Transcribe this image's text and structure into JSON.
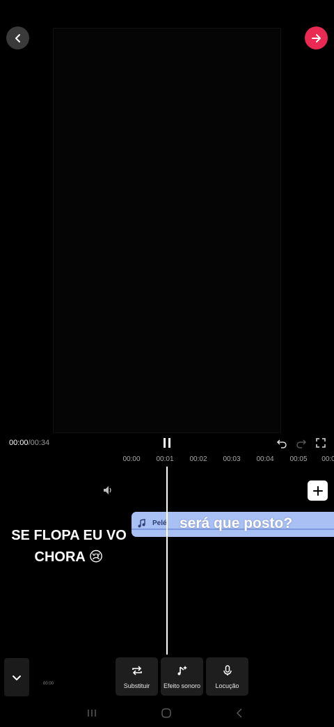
{
  "header": {
    "back_icon": "chevron-left-icon",
    "next_icon": "arrow-right-icon",
    "next_color": "#ea2a53"
  },
  "player": {
    "current_time": "00:00",
    "separator": "/",
    "total_time": "00:34",
    "play_state_icon": "pause-icon"
  },
  "ruler": {
    "ticks": [
      "00:00",
      "00:01",
      "00:02",
      "00:03",
      "00:04",
      "00:05",
      "00:0"
    ]
  },
  "timeline": {
    "audio_clip_name": "Pelé",
    "audio_clip_color": "#a9c0f4",
    "caption_question": "será que posto?",
    "overlay_text_line1": "SE FLOPA EU VO",
    "overlay_text_line2": "CHORA 😢"
  },
  "toolbar": {
    "tiny_time": "00:00",
    "items": [
      {
        "label": "Substituir",
        "icon": "replace-icon"
      },
      {
        "label": "Efeito sonoro",
        "icon": "sound-effect-icon"
      },
      {
        "label": "Locução",
        "icon": "microphone-icon"
      }
    ]
  }
}
